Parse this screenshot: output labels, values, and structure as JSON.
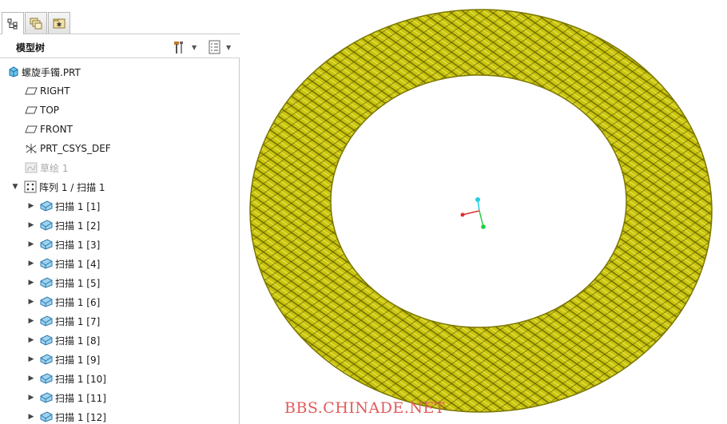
{
  "tabs": [
    {
      "name": "model-tree-tab",
      "icon": "model-tree-icon",
      "active": true
    },
    {
      "name": "folder-browser-tab",
      "icon": "folder-browser-icon",
      "active": false
    },
    {
      "name": "favorites-tab",
      "icon": "favorites-icon",
      "active": false
    }
  ],
  "tree": {
    "title": "模型树",
    "settings_icon": "tools-icon",
    "columns_icon": "list-icon",
    "items": [
      {
        "label": "螺旋手镯.PRT",
        "icon": "part-icon",
        "level": 0,
        "expander": ""
      },
      {
        "label": "RIGHT",
        "icon": "datum-plane-icon",
        "level": 1,
        "expander": ""
      },
      {
        "label": "TOP",
        "icon": "datum-plane-icon",
        "level": 1,
        "expander": ""
      },
      {
        "label": "FRONT",
        "icon": "datum-plane-icon",
        "level": 1,
        "expander": ""
      },
      {
        "label": "PRT_CSYS_DEF",
        "icon": "coordinate-system-icon",
        "level": 1,
        "expander": ""
      },
      {
        "label": "草绘 1",
        "icon": "sketch-icon",
        "level": 1,
        "expander": "",
        "disabled": true
      },
      {
        "label": "阵列 1 / 扫描 1",
        "icon": "pattern-icon",
        "level": 1,
        "expander": "▼"
      },
      {
        "label": "扫描 1 [1]",
        "icon": "sweep-icon",
        "level": 2,
        "expander": "▶"
      },
      {
        "label": "扫描 1 [2]",
        "icon": "sweep-icon",
        "level": 2,
        "expander": "▶"
      },
      {
        "label": "扫描 1 [3]",
        "icon": "sweep-icon",
        "level": 2,
        "expander": "▶"
      },
      {
        "label": "扫描 1 [4]",
        "icon": "sweep-icon",
        "level": 2,
        "expander": "▶"
      },
      {
        "label": "扫描 1 [5]",
        "icon": "sweep-icon",
        "level": 2,
        "expander": "▶"
      },
      {
        "label": "扫描 1 [6]",
        "icon": "sweep-icon",
        "level": 2,
        "expander": "▶"
      },
      {
        "label": "扫描 1 [7]",
        "icon": "sweep-icon",
        "level": 2,
        "expander": "▶"
      },
      {
        "label": "扫描 1 [8]",
        "icon": "sweep-icon",
        "level": 2,
        "expander": "▶"
      },
      {
        "label": "扫描 1 [9]",
        "icon": "sweep-icon",
        "level": 2,
        "expander": "▶"
      },
      {
        "label": "扫描 1 [10]",
        "icon": "sweep-icon",
        "level": 2,
        "expander": "▶"
      },
      {
        "label": "扫描 1 [11]",
        "icon": "sweep-icon",
        "level": 2,
        "expander": "▶"
      },
      {
        "label": "扫描 1 [12]",
        "icon": "sweep-icon",
        "level": 2,
        "expander": "▶"
      }
    ]
  },
  "viewport": {
    "model_icon": "helix-bracelet-model",
    "triad_icon": "coordinate-triad-icon",
    "model_color": "#c9c40e",
    "triad_colors": {
      "x": "#e03030",
      "y": "#22cc44",
      "z": "#22cfe0"
    }
  },
  "watermark": "BBS.CHINADE.NET",
  "colors": {
    "selection": "#cfe3f7",
    "part_icon": "#3aa3d8",
    "sweep_icon": "#3c8fc4"
  }
}
